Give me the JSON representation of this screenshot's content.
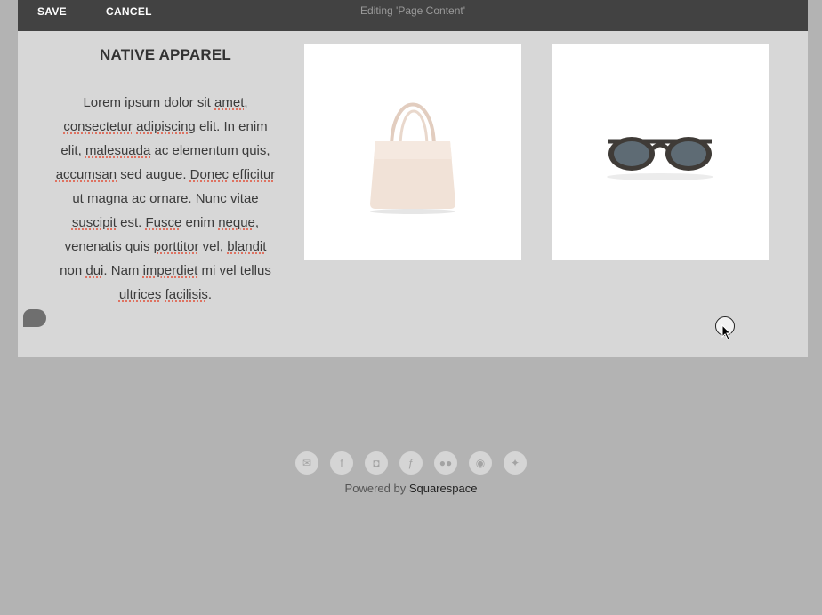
{
  "toolbar": {
    "save_label": "SAVE",
    "cancel_label": "CANCEL",
    "status": "Editing 'Page Content'"
  },
  "main": {
    "heading": "NATIVE APPAREL",
    "paragraph": [
      "Lorem ipsum dolor sit ",
      "amet",
      ", ",
      "consectetur",
      " ",
      "adipiscing",
      " elit. In enim elit, ",
      "malesuada",
      " ac elementum quis, ",
      "accumsan",
      " sed augue. ",
      "Donec",
      " ",
      "efficitur",
      " ut magna ac ornare. Nunc vitae ",
      "suscipit",
      " est. ",
      "Fusce",
      " enim ",
      "neque",
      ", venenatis quis ",
      "porttitor",
      " vel, ",
      "blandit",
      " non ",
      "dui",
      ". Nam ",
      "imperdiet",
      " mi vel tellus ",
      "ultrices",
      " ",
      "facilisis",
      "."
    ],
    "images": [
      {
        "name": "tote-bag-image",
        "icon": "tote-bag"
      },
      {
        "name": "sunglasses-image",
        "icon": "sunglasses"
      }
    ]
  },
  "footer": {
    "social_icons": [
      {
        "name": "email-icon",
        "glyph": "✉"
      },
      {
        "name": "facebook-icon",
        "glyph": "f"
      },
      {
        "name": "instagram-icon",
        "glyph": "◘"
      },
      {
        "name": "foursquare-icon",
        "glyph": "ƒ"
      },
      {
        "name": "flickr-icon",
        "glyph": "●●"
      },
      {
        "name": "dribbble-icon",
        "glyph": "◉"
      },
      {
        "name": "twitter-icon",
        "glyph": "✦"
      }
    ],
    "powered_prefix": "Powered by ",
    "powered_brand": "Squarespace"
  }
}
